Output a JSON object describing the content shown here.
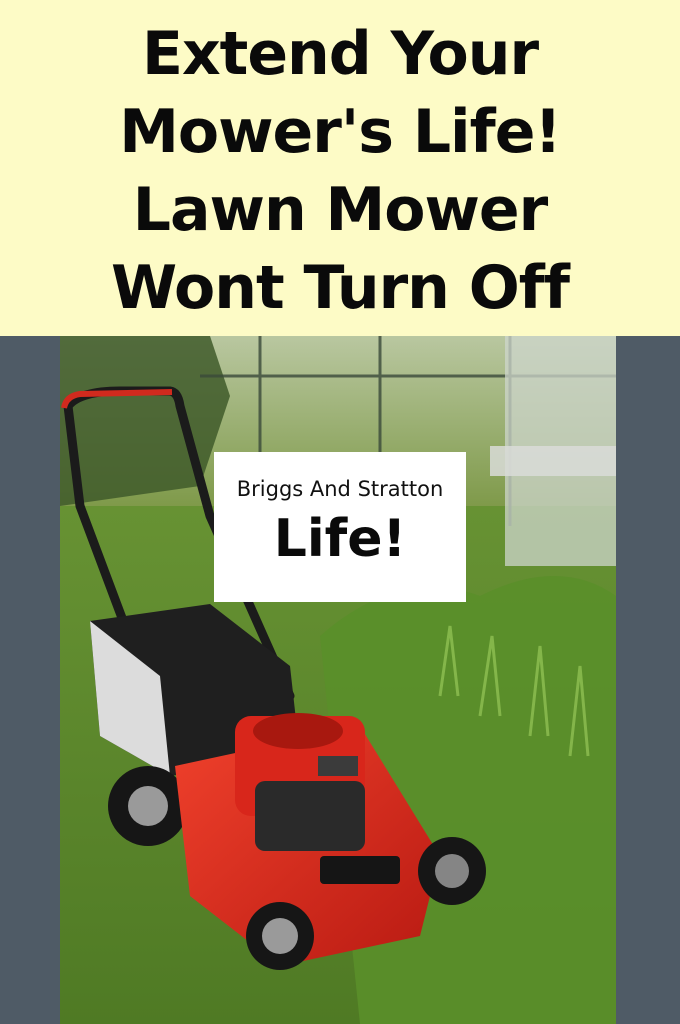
{
  "header": {
    "title_lines": [
      "Extend Your",
      "Mower's Life!",
      "Lawn Mower",
      "Wont Turn Off"
    ]
  },
  "label": {
    "subtitle": "Briggs And Stratton",
    "main": "Life!"
  },
  "colors": {
    "header_bg": "#fdfbc6",
    "side_bars": "#4f5b66",
    "grass": "#5f8f2e",
    "mower_deck": "#e0281c",
    "text": "#0a0a0a"
  },
  "photo": {
    "subject": "lawn-mower-photo"
  }
}
